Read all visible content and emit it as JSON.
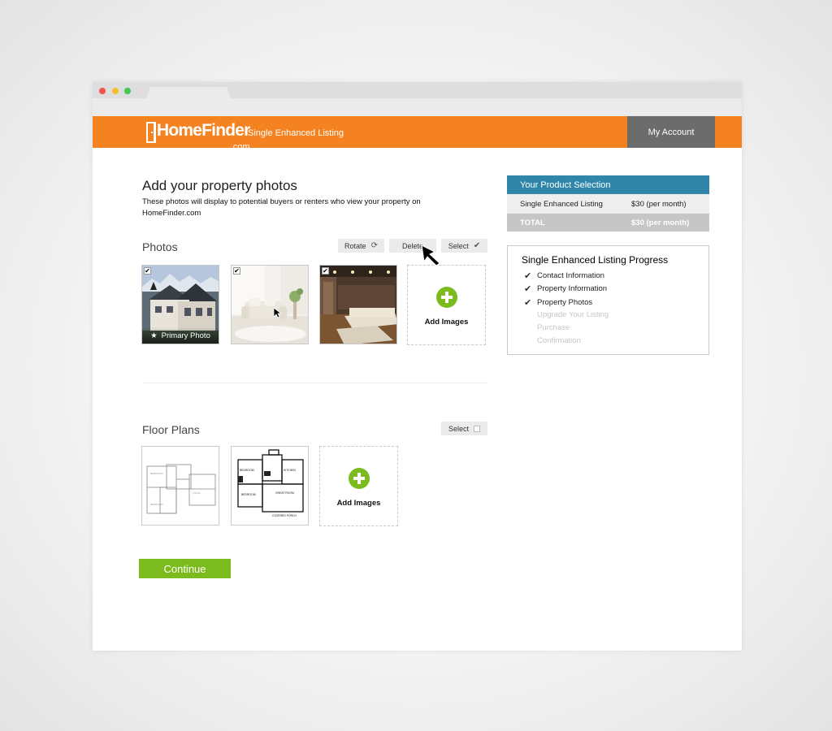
{
  "header": {
    "logo_text": "HomeFinder",
    "logo_suffix": ".com",
    "subtitle": "Single Enhanced Listing",
    "account_label": "My Account"
  },
  "page": {
    "title": "Add your property photos",
    "intro": "These photos will display to potential buyers or renters who view your property on HomeFinder.com"
  },
  "photos": {
    "section_title": "Photos",
    "rotate_label": "Rotate",
    "delete_label": "Delete",
    "select_label": "Select",
    "primary_label": "Primary Photo",
    "add_label": "Add Images"
  },
  "floor_plans": {
    "section_title": "Floor Plans",
    "select_label": "Select",
    "add_label": "Add Images"
  },
  "continue_label": "Continue",
  "product": {
    "heading": "Your Product Selection",
    "item_label": "Single Enhanced Listing",
    "item_price": "$30 (per month)",
    "total_label": "TOTAL",
    "total_price": "$30 (per month)"
  },
  "progress": {
    "title": "Single Enhanced Listing Progress",
    "steps": [
      {
        "label": "Contact Information",
        "done": true
      },
      {
        "label": "Property Information",
        "done": true
      },
      {
        "label": "Property Photos",
        "done": true
      },
      {
        "label": "Upgrade Your Listing",
        "done": false
      },
      {
        "label": "Purchase",
        "done": false
      },
      {
        "label": "Confirmation",
        "done": false
      }
    ]
  },
  "colors": {
    "brand_orange": "#f58220",
    "accent_blue": "#2f86a8",
    "accent_green": "#7cbb1e",
    "account_gray": "#6c6c6c"
  }
}
